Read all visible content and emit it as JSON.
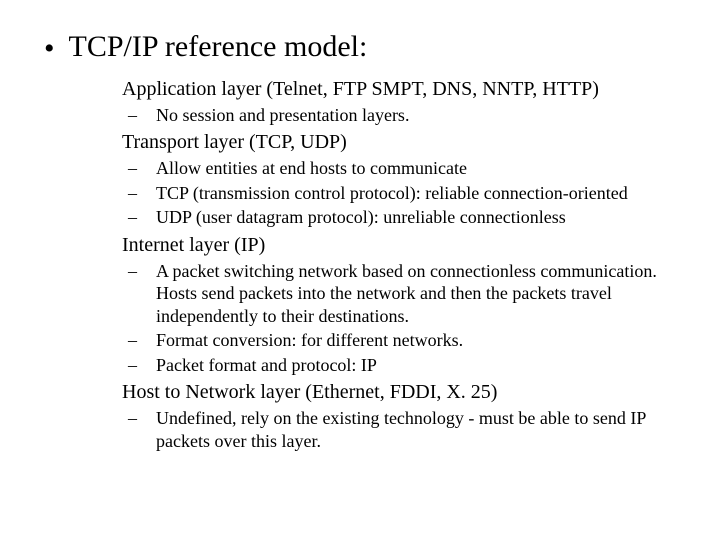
{
  "title": "TCP/IP reference model:",
  "sections": [
    {
      "heading": "Application layer   (Telnet, FTP SMPT, DNS, NNTP, HTTP)",
      "items": [
        "No session and presentation layers."
      ]
    },
    {
      "heading": "Transport layer (TCP, UDP)",
      "items": [
        "Allow entities at end hosts to communicate",
        "TCP (transmission control protocol): reliable connection-oriented",
        "UDP (user datagram protocol): unreliable connectionless"
      ]
    },
    {
      "heading": "Internet layer (IP)",
      "items": [
        "A packet switching network based on connectionless communication. Hosts send packets into the network and then the packets travel independently to their destinations.",
        "Format conversion: for different networks.",
        "Packet format and protocol: IP"
      ]
    },
    {
      "heading": "Host to Network layer (Ethernet, FDDI, X. 25)",
      "items": [
        "Undefined, rely on the existing technology - must be able to send IP packets over this layer."
      ]
    }
  ]
}
